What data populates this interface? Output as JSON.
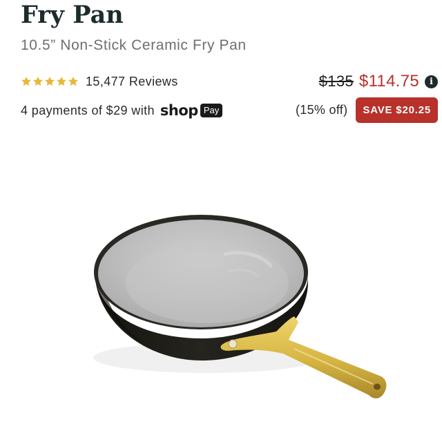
{
  "product": {
    "title": "Fry Pan",
    "subtitle": "10.5” Non-Stick Ceramic Fry Pan",
    "rating": 5,
    "reviews": "15,477 Reviews"
  },
  "pricing": {
    "original_price": "$135",
    "sale_price": "$114.75",
    "info_icon": "i",
    "percent_off": "(15% off)",
    "save_badge": "SAVE $20.25"
  },
  "payment": {
    "installments": "4 payments of $29 with",
    "provider_logo": "shop",
    "provider_badge": "Pay"
  },
  "colors": {
    "sale_red": "#b8312b",
    "star_gold": "#e6b93a",
    "title_dark": "#1d2b2c",
    "pan_body": "#1e1d19",
    "pan_interior": "#bfbfbf",
    "handle_gold": "#d8b94a"
  }
}
